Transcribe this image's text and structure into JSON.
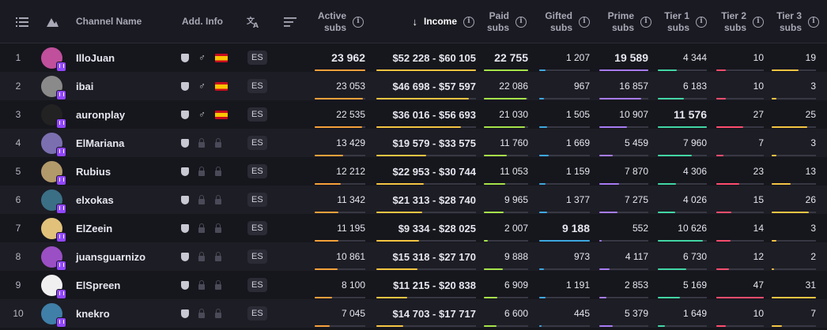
{
  "colors": {
    "active": "#f7a13b",
    "income": "#f5c542",
    "paid": "#a6e34a",
    "gifted": "#3ea8e0",
    "prime": "#a77bf3",
    "tier1": "#42d6a4",
    "tier2": "#ff4d6d",
    "tier3": "#f5c542"
  },
  "header": {
    "channel_name": "Channel Name",
    "add_info": "Add. Info",
    "active_1": "Active",
    "active_2": "subs",
    "income": "Income",
    "paid_1": "Paid",
    "paid_2": "subs",
    "gifted_1": "Gifted",
    "gifted_2": "subs",
    "prime_1": "Prime",
    "prime_2": "subs",
    "tier1_1": "Tier 1",
    "tier1_2": "subs",
    "tier2_1": "Tier 2",
    "tier2_2": "subs",
    "tier3_1": "Tier 3",
    "tier3_2": "subs",
    "info_glyph": "i",
    "sort_arrow": "↓"
  },
  "rows": [
    {
      "rank": "1",
      "name": "IlloJuan",
      "gender": "♂",
      "flag": true,
      "lang": "ES",
      "active": "23 962",
      "income": "$52 228 - $60 105",
      "paid": "22 755",
      "gifted": "1 207",
      "prime": "19 589",
      "tier1": "4 344",
      "tier2": "10",
      "tier3": "19",
      "avatar": "#c04f9c",
      "bold": [
        "active",
        "income",
        "paid",
        "prime"
      ],
      "fill": {
        "active": 1.0,
        "income": 1.0,
        "paid": 1.0,
        "gifted": 0.13,
        "prime": 1.0,
        "tier1": 0.38,
        "tier2": 0.2,
        "tier3": 0.6
      }
    },
    {
      "rank": "2",
      "name": "ibai",
      "gender": "♂",
      "flag": true,
      "lang": "ES",
      "active": "23 053",
      "income": "$46 698 - $57 597",
      "paid": "22 086",
      "gifted": "967",
      "prime": "16 857",
      "tier1": "6 183",
      "tier2": "10",
      "tier3": "3",
      "avatar": "#8a8a8a",
      "bold": [],
      "fill": {
        "active": 0.96,
        "income": 0.93,
        "paid": 0.97,
        "gifted": 0.1,
        "prime": 0.86,
        "tier1": 0.53,
        "tier2": 0.2,
        "tier3": 0.1
      }
    },
    {
      "rank": "3",
      "name": "auronplay",
      "gender": "♂",
      "flag": true,
      "lang": "ES",
      "active": "22 535",
      "income": "$36 016 - $56 693",
      "paid": "21 030",
      "gifted": "1 505",
      "prime": "10 907",
      "tier1": "11 576",
      "tier2": "27",
      "tier3": "25",
      "avatar": "#222222",
      "bold": [
        "tier1"
      ],
      "fill": {
        "active": 0.94,
        "income": 0.85,
        "paid": 0.92,
        "gifted": 0.16,
        "prime": 0.56,
        "tier1": 1.0,
        "tier2": 0.57,
        "tier3": 0.8
      }
    },
    {
      "rank": "4",
      "name": "ElMariana",
      "gender": "",
      "flag": false,
      "lang": "ES",
      "active": "13 429",
      "income": "$19 579 - $33 575",
      "paid": "11 760",
      "gifted": "1 669",
      "prime": "5 459",
      "tier1": "7 960",
      "tier2": "7",
      "tier3": "3",
      "avatar": "#7b6fb0",
      "bold": [],
      "fill": {
        "active": 0.56,
        "income": 0.5,
        "paid": 0.52,
        "gifted": 0.18,
        "prime": 0.28,
        "tier1": 0.69,
        "tier2": 0.15,
        "tier3": 0.1
      }
    },
    {
      "rank": "5",
      "name": "Rubius",
      "gender": "",
      "flag": false,
      "lang": "ES",
      "active": "12 212",
      "income": "$22 953 - $30 744",
      "paid": "11 053",
      "gifted": "1 159",
      "prime": "7 870",
      "tier1": "4 306",
      "tier2": "23",
      "tier3": "13",
      "avatar": "#b39a6a",
      "bold": [],
      "fill": {
        "active": 0.51,
        "income": 0.48,
        "paid": 0.49,
        "gifted": 0.13,
        "prime": 0.4,
        "tier1": 0.37,
        "tier2": 0.49,
        "tier3": 0.42
      }
    },
    {
      "rank": "6",
      "name": "elxokas",
      "gender": "",
      "flag": false,
      "lang": "ES",
      "active": "11 342",
      "income": "$21 313 - $28 740",
      "paid": "9 965",
      "gifted": "1 377",
      "prime": "7 275",
      "tier1": "4 026",
      "tier2": "15",
      "tier3": "26",
      "avatar": "#3a6f86",
      "bold": [],
      "fill": {
        "active": 0.47,
        "income": 0.46,
        "paid": 0.44,
        "gifted": 0.15,
        "prime": 0.37,
        "tier1": 0.35,
        "tier2": 0.32,
        "tier3": 0.84
      }
    },
    {
      "rank": "7",
      "name": "ElZeein",
      "gender": "",
      "flag": false,
      "lang": "ES",
      "active": "11 195",
      "income": "$9 334 - $28 025",
      "paid": "2 007",
      "gifted": "9 188",
      "prime": "552",
      "tier1": "10 626",
      "tier2": "14",
      "tier3": "3",
      "avatar": "#e2c27a",
      "bold": [
        "gifted"
      ],
      "fill": {
        "active": 0.47,
        "income": 0.43,
        "paid": 0.09,
        "gifted": 1.0,
        "prime": 0.03,
        "tier1": 0.92,
        "tier2": 0.3,
        "tier3": 0.1
      }
    },
    {
      "rank": "8",
      "name": "juansguarnizo",
      "gender": "",
      "flag": false,
      "lang": "ES",
      "active": "10 861",
      "income": "$15 318 - $27 170",
      "paid": "9 888",
      "gifted": "973",
      "prime": "4 117",
      "tier1": "6 730",
      "tier2": "12",
      "tier3": "2",
      "avatar": "#9a4fc4",
      "bold": [],
      "fill": {
        "active": 0.45,
        "income": 0.41,
        "paid": 0.43,
        "gifted": 0.1,
        "prime": 0.21,
        "tier1": 0.58,
        "tier2": 0.26,
        "tier3": 0.06
      }
    },
    {
      "rank": "9",
      "name": "ElSpreen",
      "gender": "",
      "flag": false,
      "lang": "ES",
      "active": "8 100",
      "income": "$11 215 - $20 838",
      "paid": "6 909",
      "gifted": "1 191",
      "prime": "2 853",
      "tier1": "5 169",
      "tier2": "47",
      "tier3": "31",
      "avatar": "#f0f0f0",
      "bold": [],
      "fill": {
        "active": 0.34,
        "income": 0.31,
        "paid": 0.3,
        "gifted": 0.13,
        "prime": 0.15,
        "tier1": 0.45,
        "tier2": 1.0,
        "tier3": 1.0
      }
    },
    {
      "rank": "10",
      "name": "knekro",
      "gender": "",
      "flag": false,
      "lang": "ES",
      "active": "7 045",
      "income": "$14 703 - $17 717",
      "paid": "6 600",
      "gifted": "445",
      "prime": "5 379",
      "tier1": "1 649",
      "tier2": "10",
      "tier3": "7",
      "avatar": "#3f7fa8",
      "bold": [],
      "fill": {
        "active": 0.29,
        "income": 0.27,
        "paid": 0.29,
        "gifted": 0.05,
        "prime": 0.27,
        "tier1": 0.14,
        "tier2": 0.2,
        "tier3": 0.23
      }
    }
  ]
}
